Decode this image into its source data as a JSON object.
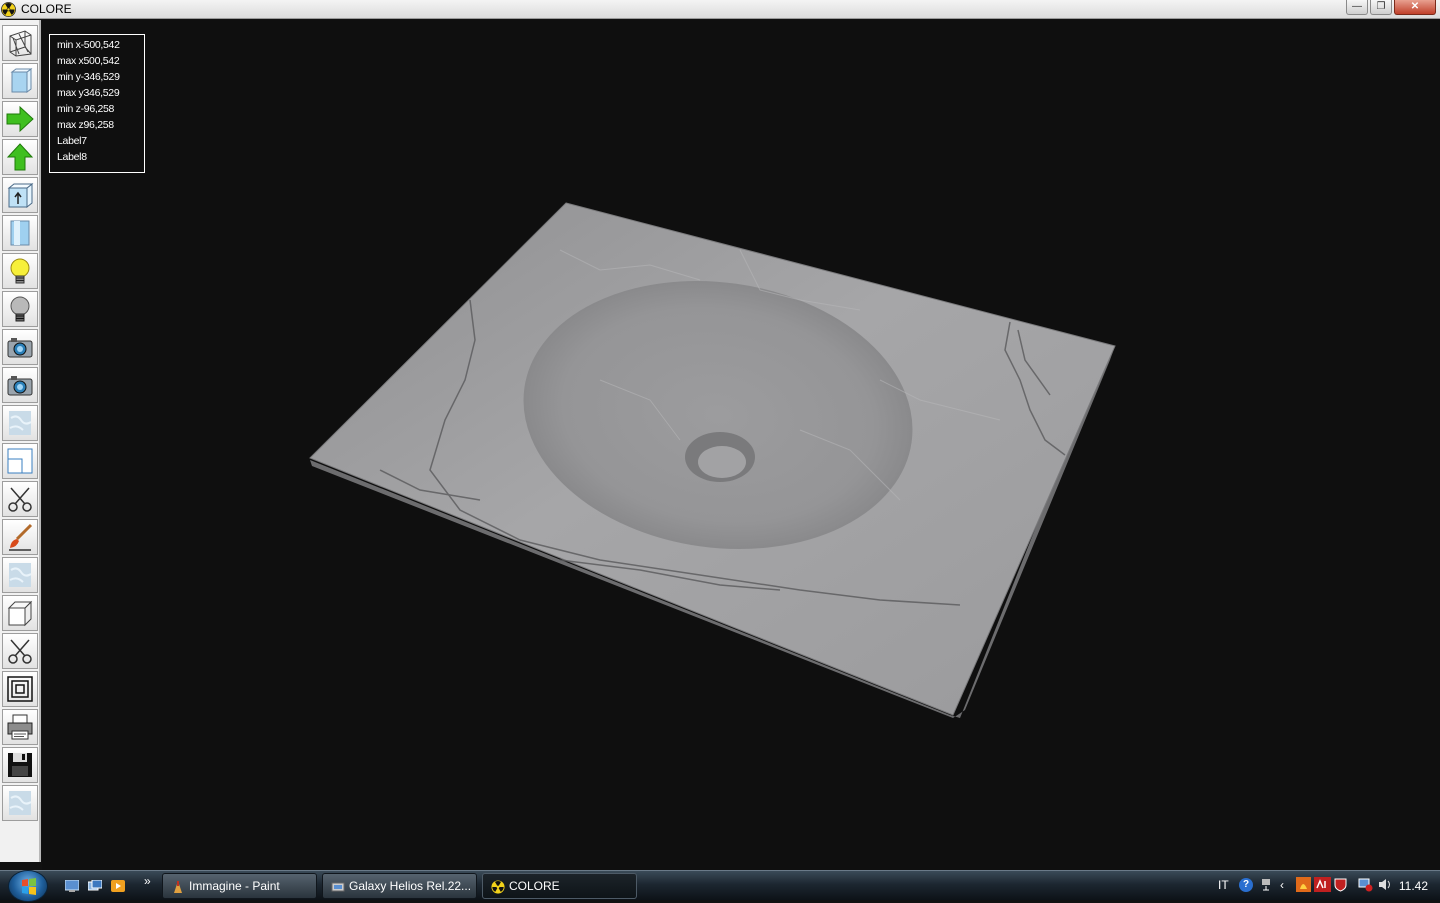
{
  "window": {
    "title": "COLORE",
    "minimize_symbol": "—",
    "restore_symbol": "❐",
    "close_symbol": "✕"
  },
  "toolbar": {
    "buttons": [
      {
        "icon": "wireframe-icon"
      },
      {
        "icon": "solid-block-icon"
      },
      {
        "icon": "arrow-right-icon",
        "color": "#3fbf1f"
      },
      {
        "icon": "arrow-up-icon",
        "color": "#3fbf1f"
      },
      {
        "icon": "box-up-arrow-icon"
      },
      {
        "icon": "cylinder-icon"
      },
      {
        "icon": "lightbulb-on-icon"
      },
      {
        "icon": "lightbulb-off-icon"
      },
      {
        "icon": "camera-icon"
      },
      {
        "icon": "camera-icon"
      },
      {
        "icon": "texture-icon"
      },
      {
        "icon": "view-window-icon"
      },
      {
        "icon": "scissors-icon"
      },
      {
        "icon": "paint-brush-icon"
      },
      {
        "icon": "texture-icon"
      },
      {
        "icon": "cube-icon"
      },
      {
        "icon": "scissors-icon"
      },
      {
        "icon": "nested-squares-icon"
      },
      {
        "icon": "printer-icon"
      },
      {
        "icon": "floppy-save-icon"
      },
      {
        "icon": "texture-icon"
      }
    ]
  },
  "info": {
    "min_x": "min x-500,542",
    "max_x": "max x500,542",
    "min_y": "min y-346,529",
    "max_y": "max y346,529",
    "min_z": "min z-96,258",
    "max_z": "max z96,258",
    "label7": "Label7",
    "label8": "Label8"
  },
  "taskbar": {
    "more_symbol": "»",
    "tasks": [
      {
        "label": "Immagine - Paint"
      },
      {
        "label": "Galaxy Helios  Rel.22..."
      },
      {
        "label": "COLORE"
      }
    ],
    "tray": {
      "language": "IT",
      "help_symbol": "?",
      "expand_symbol": "‹",
      "clock": "11.42"
    }
  },
  "colors": {
    "viewport_bg": "#0f0f0f",
    "marble": "#a3a3a5",
    "accent_radiation": "#f2d21a"
  }
}
